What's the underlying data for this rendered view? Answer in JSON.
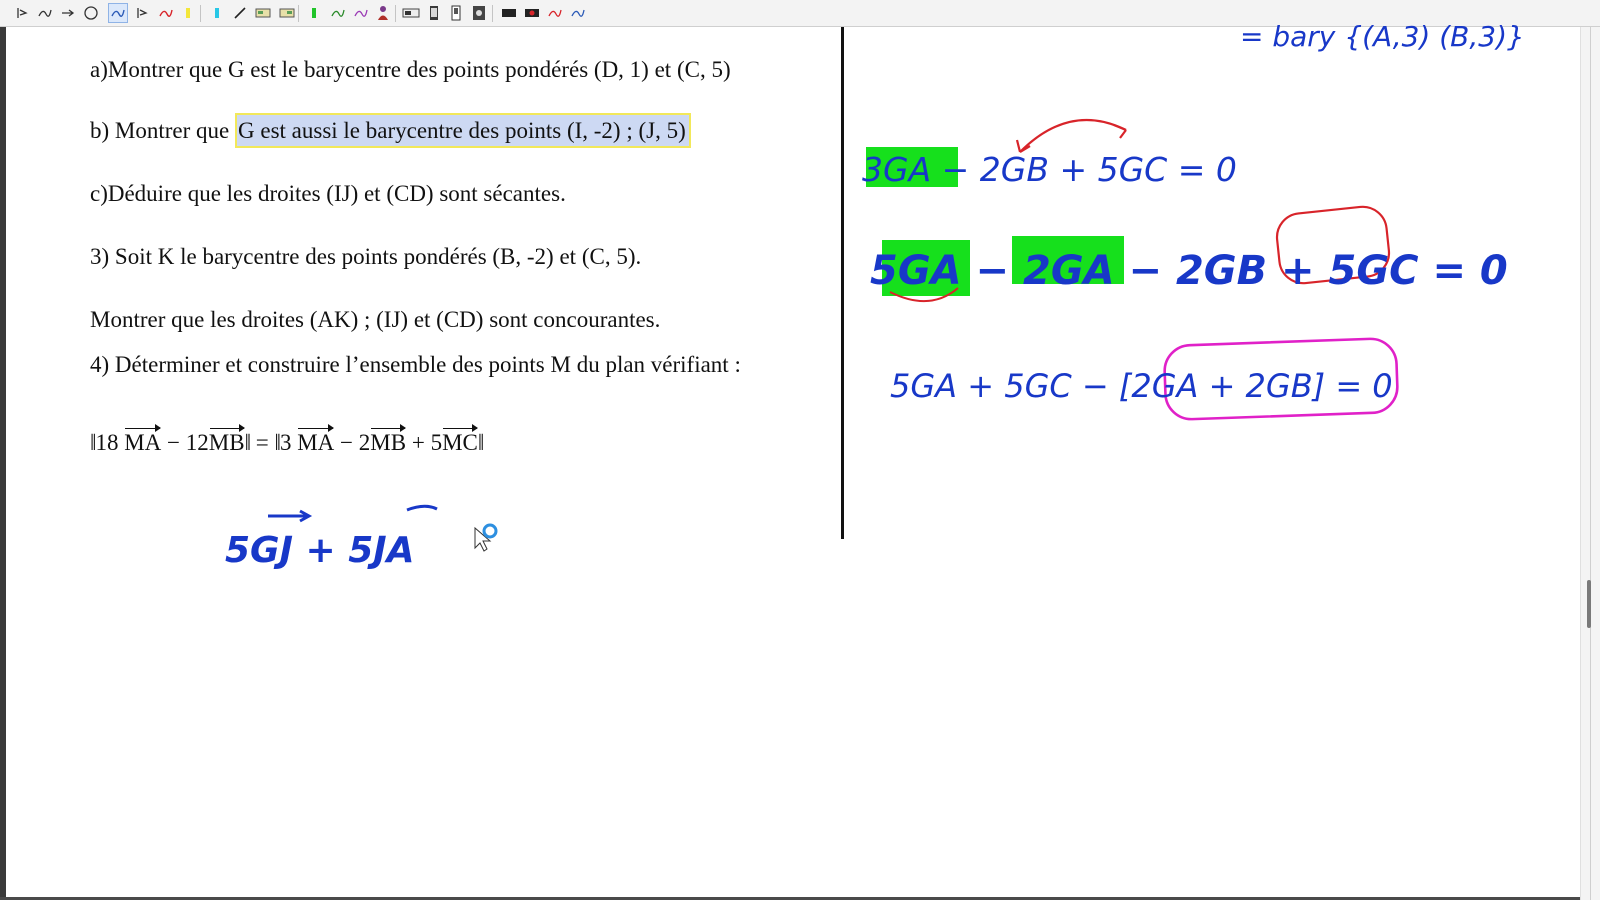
{
  "toolbar": {
    "tools": [
      "pointer-tool",
      "pen-tool",
      "arrow-tool",
      "circle-tool",
      "pen-tool-active",
      "pointer-tool-2",
      "red-pen-tool",
      "yellow-highlighter-tool",
      "cyan-highlighter-tool",
      "line-tool",
      "screen-tool",
      "screen-tool-2",
      "green-highlighter-tool",
      "green-pen-tool",
      "purple-pen-tool",
      "person-tool",
      "screen-tool-3",
      "phone-tool",
      "phone-tool-2",
      "camera-tool",
      "black-screen-tool",
      "record-tool",
      "red-pen-tool-2",
      "blue-pen-tool"
    ]
  },
  "exercise": {
    "line_a": "a)Montrer que G est le barycentre des points pondérés (D, 1) et (C, 5)",
    "line_b_prefix": "b) Montrer que ",
    "line_b_highlight": "G est aussi le barycentre des points (I, -2) ; (J, 5)",
    "line_c": "c)Déduire que les droites (IJ) et (CD) sont sécantes.",
    "line_3": "3) Soit K le barycentre des points pondérés (B, -2) et (C, 5).",
    "line_3b": "Montrer que les droites (AK) ; (IJ) et (CD) sont concourantes.",
    "line_4": "4) Déterminer et construire l’ensemble des points M du plan vérifiant :",
    "formula": {
      "coef1": "18",
      "vec1": "MA",
      "op1": "−",
      "coef2": "12",
      "vec2": "MB",
      "equals": "=",
      "coef3": "3",
      "vec3": "MA",
      "op2": "−",
      "coef4": "2",
      "vec4": "MB",
      "op3": "+",
      "coef5": "5",
      "vec5": "MC"
    }
  },
  "annotations": {
    "top_right": "= bary {(A,3) (B,3)}",
    "eq1": "3GA − 2GB + 5GC = 0",
    "eq2": "5GA − 2GA − 2GB + 5GC = 0",
    "eq3": "5GA + 5GC − [2GA + 2GB] = 0",
    "bottom_left": "5GJ + 5JA"
  },
  "colors": {
    "ink_blue": "#1838c8",
    "ink_red": "#d8242a",
    "ink_magenta": "#e021c8",
    "highlight_green": "#16e01c",
    "text_highlight_blue": "#cdd9f3",
    "text_highlight_border": "#f2e85a"
  }
}
